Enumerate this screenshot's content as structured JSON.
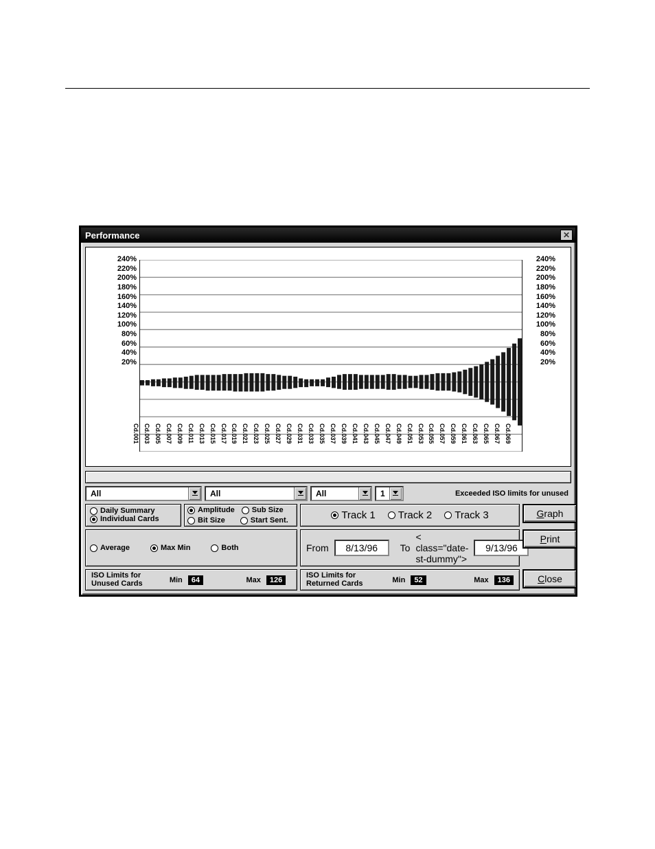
{
  "window": {
    "title": "Performance"
  },
  "chart_data": {
    "type": "bar-range",
    "ylabel_suffix": "%",
    "yticks": [
      20,
      40,
      60,
      80,
      100,
      120,
      140,
      160,
      180,
      200,
      220,
      240
    ],
    "x_labels": [
      "Cd.001",
      "Cd.003",
      "Cd.005",
      "Cd.007",
      "Cd.009",
      "Cd.011",
      "Cd.013",
      "Cd.015",
      "Cd.017",
      "Cd.019",
      "Cd.021",
      "Cd.023",
      "Cd.025",
      "Cd.027",
      "Cd.029",
      "Cd.031",
      "Cd.033",
      "Cd.035",
      "Cd.037",
      "Cd.039",
      "Cd.041",
      "Cd.043",
      "Cd.045",
      "Cd.047",
      "Cd.049",
      "Cd.051",
      "Cd.053",
      "Cd.055",
      "Cd.057",
      "Cd.059",
      "Cd.061",
      "Cd.063",
      "Cd.065",
      "Cd.067",
      "Cd.069"
    ],
    "series": [
      {
        "name": "MaxMin",
        "n": 70,
        "max": [
          102,
          102,
          103,
          103,
          104,
          104,
          105,
          105,
          106,
          107,
          108,
          108,
          108,
          108,
          108,
          109,
          109,
          109,
          109,
          110,
          110,
          110,
          110,
          109,
          109,
          108,
          107,
          107,
          106,
          104,
          103,
          103,
          103,
          103,
          105,
          106,
          108,
          109,
          109,
          109,
          108,
          108,
          108,
          108,
          108,
          109,
          109,
          108,
          108,
          107,
          107,
          108,
          108,
          109,
          110,
          110,
          110,
          111,
          112,
          114,
          116,
          118,
          120,
          123,
          126,
          130,
          134,
          139,
          144,
          150
        ],
        "min": [
          96,
          96,
          95,
          95,
          94,
          94,
          93,
          93,
          92,
          92,
          91,
          91,
          90,
          90,
          90,
          90,
          90,
          89,
          89,
          89,
          89,
          89,
          89,
          90,
          90,
          91,
          92,
          92,
          93,
          94,
          94,
          95,
          95,
          95,
          94,
          93,
          92,
          91,
          91,
          91,
          92,
          92,
          92,
          92,
          92,
          91,
          91,
          92,
          92,
          93,
          93,
          92,
          92,
          91,
          90,
          90,
          90,
          89,
          88,
          86,
          84,
          82,
          80,
          77,
          74,
          70,
          66,
          61,
          56,
          50
        ]
      }
    ]
  },
  "filters": {
    "combo1": "All",
    "combo2": "All",
    "combo3": "All",
    "combo4": "1",
    "exceeded_label": "Exceeded ISO limits for unused"
  },
  "view_group": {
    "daily_summary": "Daily Summary",
    "individual_cards": "Individual Cards",
    "selected": "individual_cards"
  },
  "metric_group": {
    "amplitude": "Amplitude",
    "sub_size": "Sub Size",
    "bit_size": "Bit Size",
    "start_sent": "Start Sent.",
    "selected": "amplitude"
  },
  "stat_group": {
    "average": "Average",
    "max_min": "Max Min",
    "both": "Both",
    "selected": "max_min"
  },
  "track_group": {
    "track1": "Track 1",
    "track2": "Track 2",
    "track3": "Track 3",
    "selected": "track1"
  },
  "dates": {
    "from_label": "From",
    "from_value": "8/13/96",
    "to_label": "To",
    "to_value": "9/13/96"
  },
  "iso_unused": {
    "title_l1": "ISO Limits for",
    "title_l2": "Unused Cards",
    "min_label": "Min",
    "min_value": "64",
    "max_label": "Max",
    "max_value": "126"
  },
  "iso_returned": {
    "title_l1": "ISO Limits for",
    "title_l2": "Returned Cards",
    "min_label": "Min",
    "min_value": "52",
    "max_label": "Max",
    "max_value": "136"
  },
  "buttons": {
    "graph": "Graph",
    "print": "Print",
    "close": "Close"
  }
}
